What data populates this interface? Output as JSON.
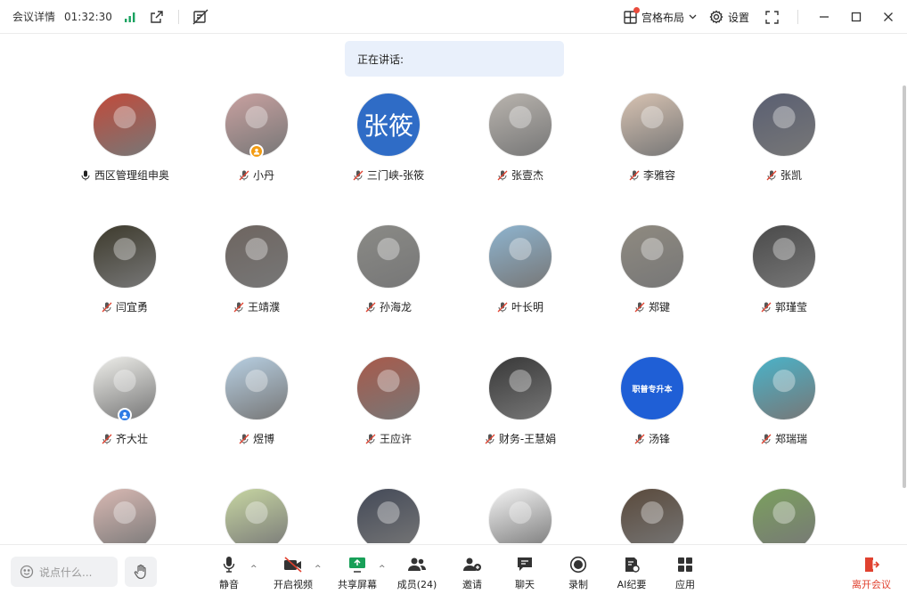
{
  "topbar": {
    "meeting_details": "会议详情",
    "duration": "01:32:30",
    "layout_label": "宫格布局",
    "settings_label": "设置"
  },
  "speaking": {
    "label": "正在讲话:"
  },
  "participants": [
    {
      "name": "西区管理组申奥",
      "mic": "on",
      "avatar": "photo",
      "color": "#c24a3a"
    },
    {
      "name": "小丹",
      "mic": "muted",
      "avatar": "photo",
      "color": "#c9a1a0",
      "badge": "#f39c12"
    },
    {
      "name": "三门峡-张筱",
      "mic": "muted",
      "avatar": "text",
      "avatar_text": "张筱",
      "color": "#2f6cc6"
    },
    {
      "name": "张壹杰",
      "mic": "muted",
      "avatar": "photo",
      "color": "#b9b4ae"
    },
    {
      "name": "李雅容",
      "mic": "muted",
      "avatar": "photo",
      "color": "#d8c3b2"
    },
    {
      "name": "张凯",
      "mic": "muted",
      "avatar": "photo",
      "color": "#5a5f72"
    },
    {
      "name": "闫宜勇",
      "mic": "muted",
      "avatar": "photo",
      "color": "#3d3a2c"
    },
    {
      "name": "王靖濮",
      "mic": "muted",
      "avatar": "photo",
      "color": "#6e6560"
    },
    {
      "name": "孙海龙",
      "mic": "muted",
      "avatar": "photo",
      "color": "#8a8a86"
    },
    {
      "name": "叶长明",
      "mic": "muted",
      "avatar": "photo",
      "color": "#8eb4cf"
    },
    {
      "name": "郑键",
      "mic": "muted",
      "avatar": "photo",
      "color": "#8f8a80"
    },
    {
      "name": "郭瑾莹",
      "mic": "muted",
      "avatar": "photo",
      "color": "#4a4a4a"
    },
    {
      "name": "齐大壮",
      "mic": "muted",
      "avatar": "photo",
      "color": "#eeeeea",
      "badge": "#2d7be5"
    },
    {
      "name": "煜博",
      "mic": "muted",
      "avatar": "photo",
      "color": "#b7cfe2"
    },
    {
      "name": "王应许",
      "mic": "muted",
      "avatar": "photo",
      "color": "#a85a4b"
    },
    {
      "name": "财务-王慧娟",
      "mic": "muted",
      "avatar": "photo",
      "color": "#383838"
    },
    {
      "name": "汤锋",
      "mic": "muted",
      "avatar": "logo",
      "avatar_text": "职普专升本",
      "color": "#1f5fd6"
    },
    {
      "name": "郑瑞瑞",
      "mic": "muted",
      "avatar": "photo",
      "color": "#4ab3c9"
    },
    {
      "name": "",
      "mic": "none",
      "avatar": "photo",
      "color": "#d9b9b3"
    },
    {
      "name": "",
      "mic": "none",
      "avatar": "photo",
      "color": "#c7d6a2"
    },
    {
      "name": "",
      "mic": "none",
      "avatar": "photo",
      "color": "#444a58"
    },
    {
      "name": "",
      "mic": "none",
      "avatar": "photo",
      "color": "#f4f4f4"
    },
    {
      "name": "",
      "mic": "none",
      "avatar": "photo",
      "color": "#5a4a3c"
    },
    {
      "name": "",
      "mic": "none",
      "avatar": "photo",
      "color": "#7ba05e"
    }
  ],
  "bottombar": {
    "chat_placeholder": "说点什么...",
    "mute": "静音",
    "start_video": "开启视频",
    "share_screen": "共享屏幕",
    "members": "成员(24)",
    "invite": "邀请",
    "chat": "聊天",
    "record": "录制",
    "ai_minutes": "AI纪要",
    "apps": "应用",
    "leave": "离开会议"
  },
  "colors": {
    "accent_blue": "#2f6cc6",
    "leave_red": "#e0412f",
    "share_green": "#18a058",
    "signal_green": "#1aa260"
  }
}
